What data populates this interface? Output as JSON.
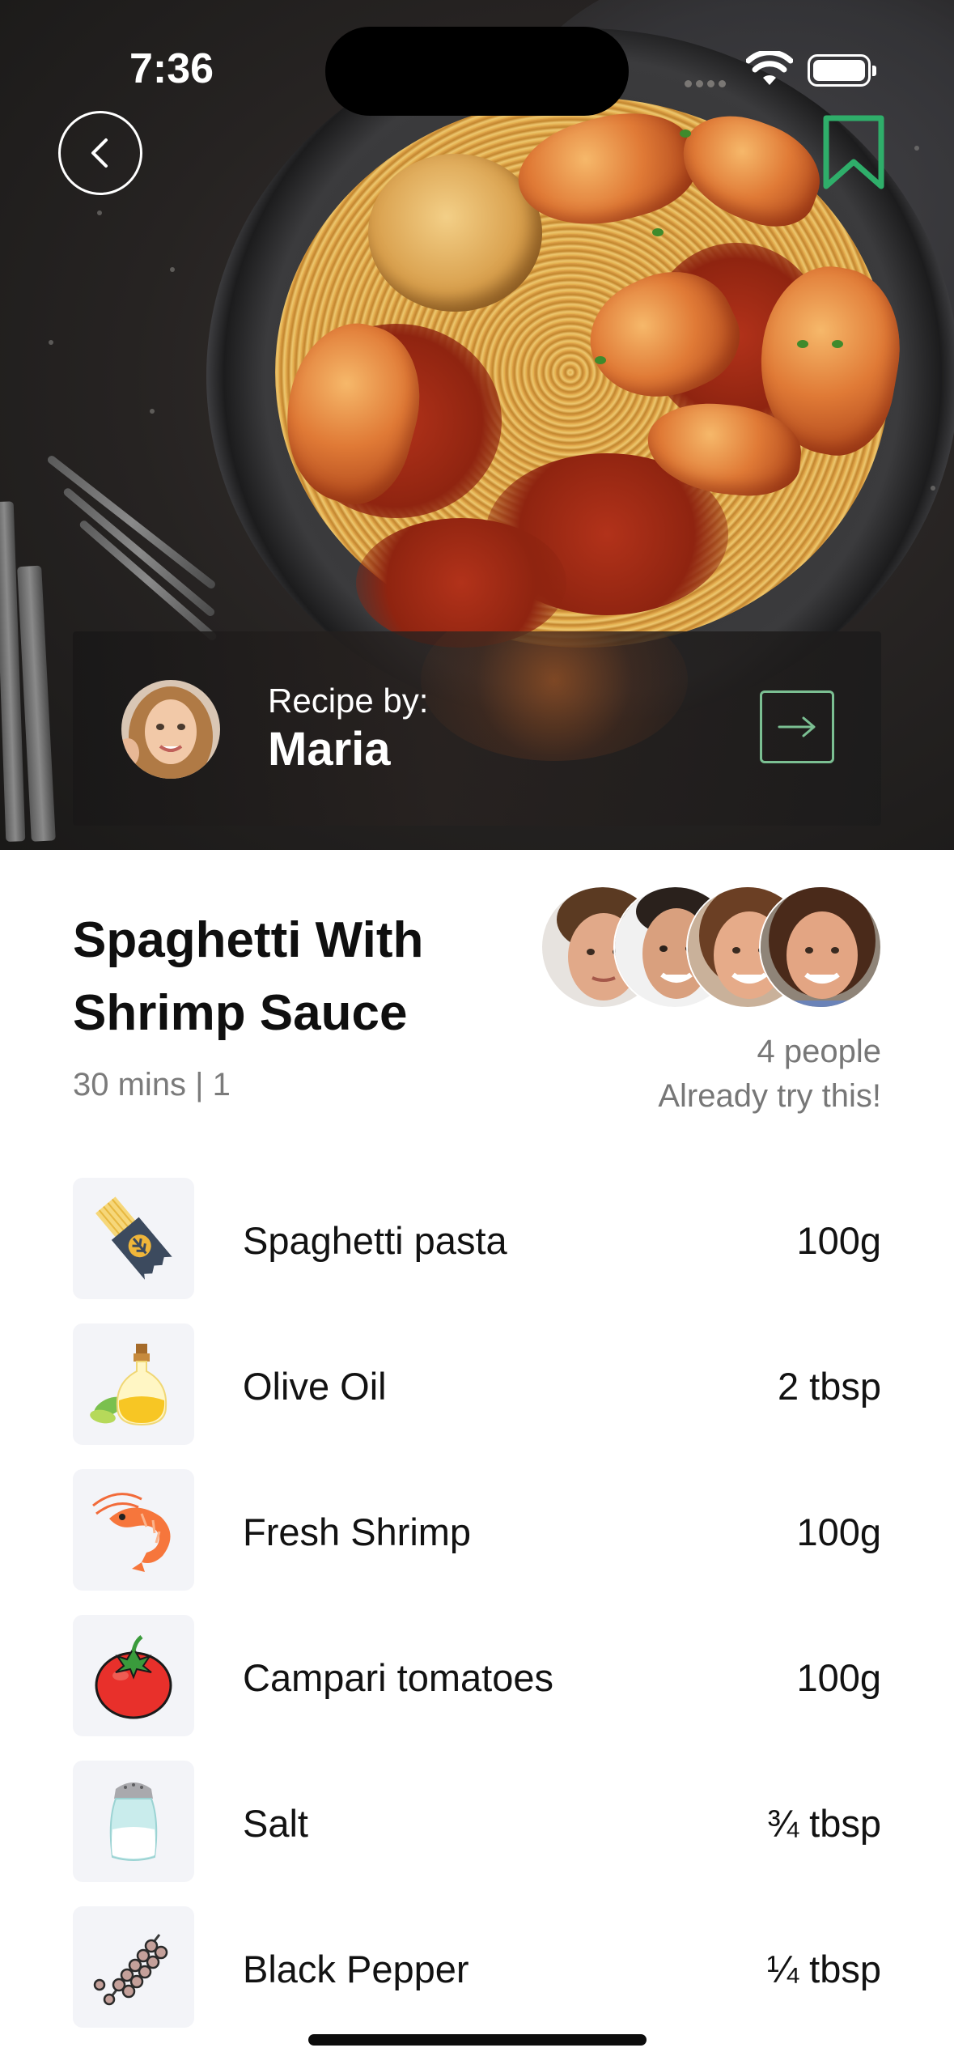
{
  "status_bar": {
    "time": "7:36"
  },
  "author": {
    "label": "Recipe by:",
    "name": "Maria"
  },
  "recipe": {
    "title": "Spaghetti With Shrimp Sauce",
    "meta": "30 mins | 1",
    "tried_count": "4 people",
    "tried_label": "Already try this!"
  },
  "ingredients": [
    {
      "name": "Spaghetti pasta",
      "qty": "100g",
      "icon": "pasta-icon"
    },
    {
      "name": "Olive Oil",
      "qty": "2 tbsp",
      "icon": "olive-oil-icon"
    },
    {
      "name": "Fresh Shrimp",
      "qty": "100g",
      "icon": "shrimp-icon"
    },
    {
      "name": "Campari tomatoes",
      "qty": "100g",
      "icon": "tomato-icon"
    },
    {
      "name": "Salt",
      "qty": "¾ tbsp",
      "icon": "salt-icon"
    },
    {
      "name": "Black Pepper",
      "qty": "¼ tbsp",
      "icon": "pepper-icon"
    }
  ],
  "colors": {
    "accent_green": "#2fae6a",
    "text_dark": "#121212",
    "muted": "#777777",
    "icon_tile": "#f3f4f8"
  }
}
